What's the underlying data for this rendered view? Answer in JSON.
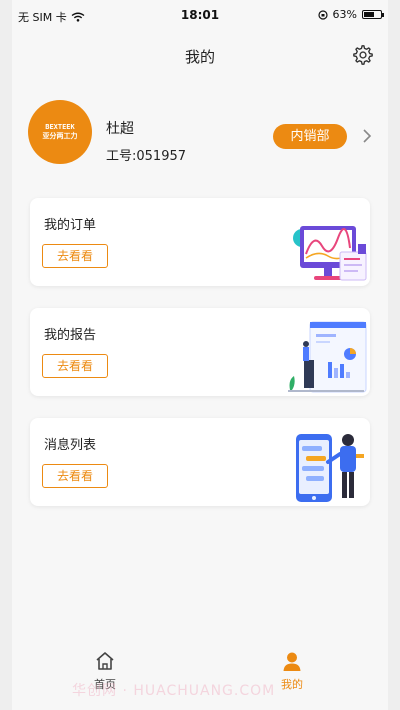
{
  "status_bar": {
    "carrier": "无 SIM 卡",
    "time": "18:01",
    "battery": "63%",
    "battery_level": 0.63
  },
  "header": {
    "title": "我的"
  },
  "profile": {
    "avatar_line1": "BEXTEEK",
    "avatar_line2": "亚分两工力",
    "name": "杜超",
    "employee_id": "工号:051957",
    "department": "内销部"
  },
  "cards": [
    {
      "title": "我的订单",
      "button": "去看看",
      "illustration": "analytics-monitor-illustration"
    },
    {
      "title": "我的报告",
      "button": "去看看",
      "illustration": "report-dashboard-illustration"
    },
    {
      "title": "消息列表",
      "button": "去看看",
      "illustration": "mobile-messages-illustration"
    }
  ],
  "tab_bar": {
    "items": [
      {
        "label": "首页",
        "icon": "home-icon",
        "active": false
      },
      {
        "label": "我的",
        "icon": "user-icon",
        "active": true
      }
    ]
  },
  "watermark": "华创网 · HUACHUANG.COM",
  "colors": {
    "accent": "#ec8a12",
    "background": "#f7f7f7",
    "card": "#ffffff"
  }
}
